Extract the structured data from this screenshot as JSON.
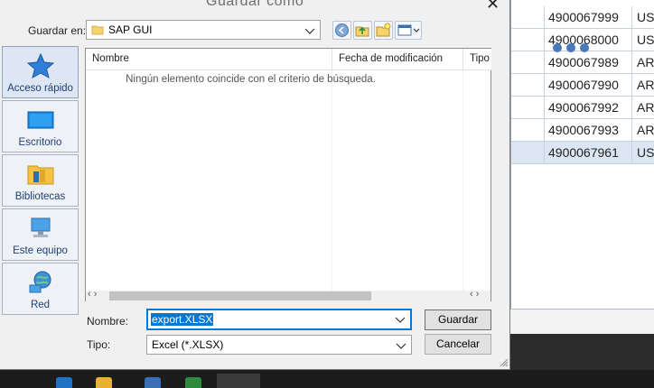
{
  "dialog": {
    "title": "Guardar como",
    "save_in_label": "Guardar en:",
    "save_in_value": "SAP GUI",
    "filename_label": "Nombre:",
    "filename_value": "export.XLSX",
    "type_label": "Tipo:",
    "type_value": "Excel (*.XLSX)",
    "save_button": "Guardar",
    "cancel_button": "Cancelar"
  },
  "places": [
    {
      "label": "Acceso rápido",
      "icon": "star-icon"
    },
    {
      "label": "Escritorio",
      "icon": "desktop-icon"
    },
    {
      "label": "Bibliotecas",
      "icon": "libraries-icon"
    },
    {
      "label": "Este equipo",
      "icon": "computer-icon"
    },
    {
      "label": "Red",
      "icon": "network-icon"
    }
  ],
  "filelist": {
    "columns": [
      "Nombre",
      "Fecha de modificación",
      "Tipo"
    ],
    "empty_message": "Ningún elemento coincide con el criterio de búsqueda."
  },
  "background_grid": {
    "rows": [
      {
        "id": "4900067999",
        "code": "US"
      },
      {
        "id": "4900068000",
        "code": "US"
      },
      {
        "id": "4900067989",
        "code": "AR"
      },
      {
        "id": "4900067990",
        "code": "AR"
      },
      {
        "id": "4900067992",
        "code": "AR"
      },
      {
        "id": "4900067993",
        "code": "AR"
      },
      {
        "id": "4900067961",
        "code": "US"
      }
    ]
  },
  "colors": {
    "accent": "#0078d7",
    "place_label": "#1e3f73",
    "loading_dots": "#4a79b8"
  }
}
